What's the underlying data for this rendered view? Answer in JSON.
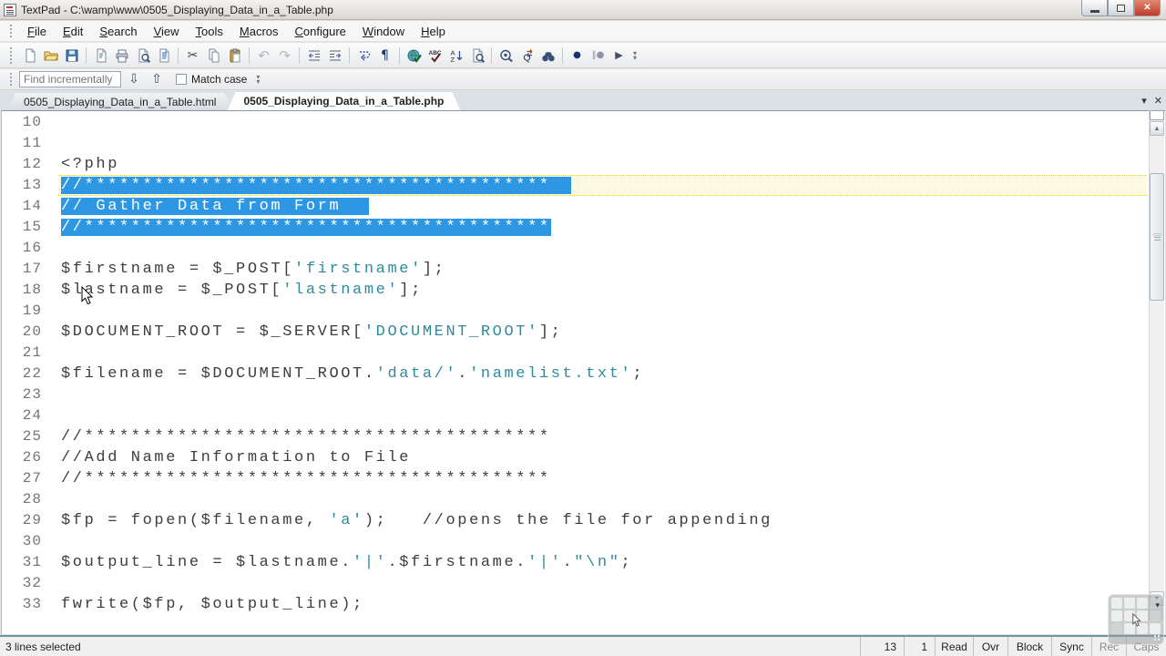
{
  "window": {
    "title": "TextPad - C:\\wamp\\www\\0505_Displaying_Data_in_a_Table.php",
    "controls": {
      "minimize": "minimize",
      "restore": "restore",
      "close": "x"
    }
  },
  "menu": {
    "items": [
      "File",
      "Edit",
      "Search",
      "View",
      "Tools",
      "Macros",
      "Configure",
      "Window",
      "Help"
    ]
  },
  "toolbar": {
    "groups": [
      [
        "new-document",
        "open-folder",
        "save"
      ],
      [
        "file-properties",
        "print",
        "print-preview",
        "document-view"
      ],
      [
        "cut",
        "copy",
        "paste"
      ],
      [
        "undo",
        "redo"
      ],
      [
        "unindent",
        "indent"
      ],
      [
        "word-wrap",
        "formatting-marks"
      ],
      [
        "html-validate",
        "spell-check",
        "sort-az",
        "find-in-files"
      ],
      [
        "view-document",
        "replace",
        "find-binoculars"
      ],
      [
        "record-macro",
        "stop-macro",
        "play-macro"
      ]
    ]
  },
  "find_bar": {
    "placeholder": "Find incrementally",
    "down_glyph": "⇩",
    "up_glyph": "⇧",
    "match_case_label": "Match case"
  },
  "tabs": [
    {
      "label": "0505_Displaying_Data_in_a_Table.html",
      "active": false
    },
    {
      "label": "0505_Displaying_Data_in_a_Table.php",
      "active": true
    }
  ],
  "tab_controls": {
    "dropdown_glyph": "▾",
    "close_glyph": "✕"
  },
  "editor": {
    "selection_color": "#2e97e3",
    "string_color": "#2e8b9d",
    "cursor_line_color": "#fdf9e3",
    "lines": [
      {
        "num": "10",
        "segs": []
      },
      {
        "num": "11",
        "segs": []
      },
      {
        "num": "12",
        "segs": [
          [
            "<?php",
            "p"
          ]
        ]
      },
      {
        "num": "13",
        "segs": [
          [
            "//****************************************",
            "p"
          ]
        ],
        "selected": true,
        "sel_extra": 22,
        "cursor_line": true
      },
      {
        "num": "14",
        "segs": [
          [
            "// Gather Data from Form",
            "p"
          ]
        ],
        "selected": true,
        "sel_extra": 31
      },
      {
        "num": "15",
        "segs": [
          [
            "//****************************************",
            "p"
          ]
        ],
        "selected": true,
        "sel_extra": 0
      },
      {
        "num": "16",
        "segs": []
      },
      {
        "num": "17",
        "segs": [
          [
            "$firstname = $_POST[",
            "p"
          ],
          [
            "'firstname'",
            "s"
          ],
          [
            "];",
            "p"
          ]
        ]
      },
      {
        "num": "18",
        "segs": [
          [
            "$lastname = $_POST[",
            "p"
          ],
          [
            "'lastname'",
            "s"
          ],
          [
            "];",
            "p"
          ]
        ]
      },
      {
        "num": "19",
        "segs": []
      },
      {
        "num": "20",
        "segs": [
          [
            "$DOCUMENT_ROOT = $_SERVER[",
            "p"
          ],
          [
            "'DOCUMENT_ROOT'",
            "s"
          ],
          [
            "];",
            "p"
          ]
        ]
      },
      {
        "num": "21",
        "segs": []
      },
      {
        "num": "22",
        "segs": [
          [
            "$filename = $DOCUMENT_ROOT.",
            "p"
          ],
          [
            "'data/'",
            "s"
          ],
          [
            ".",
            "p"
          ],
          [
            "'namelist.txt'",
            "s"
          ],
          [
            ";",
            "p"
          ]
        ]
      },
      {
        "num": "23",
        "segs": []
      },
      {
        "num": "24",
        "segs": []
      },
      {
        "num": "25",
        "segs": [
          [
            "//****************************************",
            "p"
          ]
        ]
      },
      {
        "num": "26",
        "segs": [
          [
            "//Add Name Information to File",
            "p"
          ]
        ]
      },
      {
        "num": "27",
        "segs": [
          [
            "//****************************************",
            "p"
          ]
        ]
      },
      {
        "num": "28",
        "segs": []
      },
      {
        "num": "29",
        "segs": [
          [
            "$fp = fopen($filename, ",
            "p"
          ],
          [
            "'a'",
            "s"
          ],
          [
            ");   //opens the file for appending",
            "p"
          ]
        ]
      },
      {
        "num": "30",
        "segs": []
      },
      {
        "num": "31",
        "segs": [
          [
            "$output_line = $lastname.",
            "p"
          ],
          [
            "'|'",
            "s"
          ],
          [
            ".$firstname.",
            "p"
          ],
          [
            "'|'",
            "s"
          ],
          [
            ".",
            "p"
          ],
          [
            "\"\\n\"",
            "s"
          ],
          [
            ";",
            "p"
          ]
        ]
      },
      {
        "num": "32",
        "segs": []
      },
      {
        "num": "33",
        "segs": [
          [
            "fwrite($fp, $output_line);",
            "p"
          ]
        ]
      }
    ]
  },
  "status_bar": {
    "left": "3 lines selected",
    "cells": [
      "13",
      "1",
      "Read",
      "Ovr",
      "Block",
      "Sync",
      "Rec",
      "Caps"
    ]
  }
}
